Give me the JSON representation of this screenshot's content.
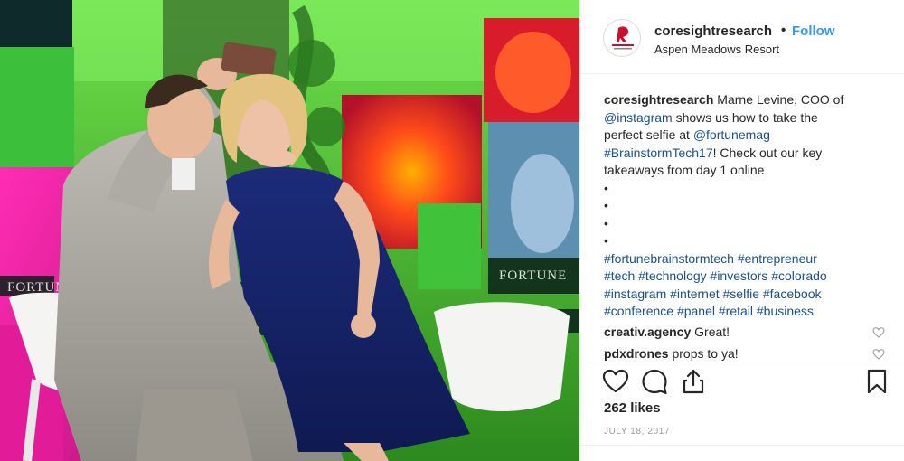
{
  "post": {
    "username": "coresightresearch",
    "separator": "•",
    "follow_label": "Follow",
    "location": "Aspen Meadows Resort",
    "avatar_icon": "coresight-logo-avatar",
    "caption": {
      "username": "coresightresearch",
      "text_1": " Marne Levine, COO of",
      "mention_instagram": "@instagram",
      "text_2": " shows us how to take the",
      "text_3": "perfect selfie at ",
      "mention_fortune": "@fortunemag",
      "hashtag_event": "#BrainstormTech17",
      "text_4": "! Check out our key",
      "text_5": "takeaways from day 1 online",
      "bullets": [
        "•",
        "•",
        "•",
        "•"
      ],
      "hashtags_line_1": "#fortunebrainstormtech #entrepreneur",
      "hashtags_line_2": "#tech #technology #investors #colorado",
      "hashtags_line_3": "#instagram #internet #selfie #facebook",
      "hashtags_line_4": "#conference #panel #retail #business"
    },
    "comments": [
      {
        "username": "creativ.agency",
        "text": " Great!"
      },
      {
        "username": "pdxdrones",
        "text": " props to ya!"
      }
    ],
    "likes": "262 likes",
    "date": "JULY 18, 2017",
    "photo_banner_text": "FORTUNE",
    "colors": {
      "link": "#1a4f8a",
      "follow": "#3897f0",
      "text": "#262626",
      "muted": "#999999",
      "logo_red": "#c8102e"
    },
    "icons": [
      "heart-icon",
      "comment-icon",
      "share-icon",
      "bookmark-icon"
    ]
  }
}
